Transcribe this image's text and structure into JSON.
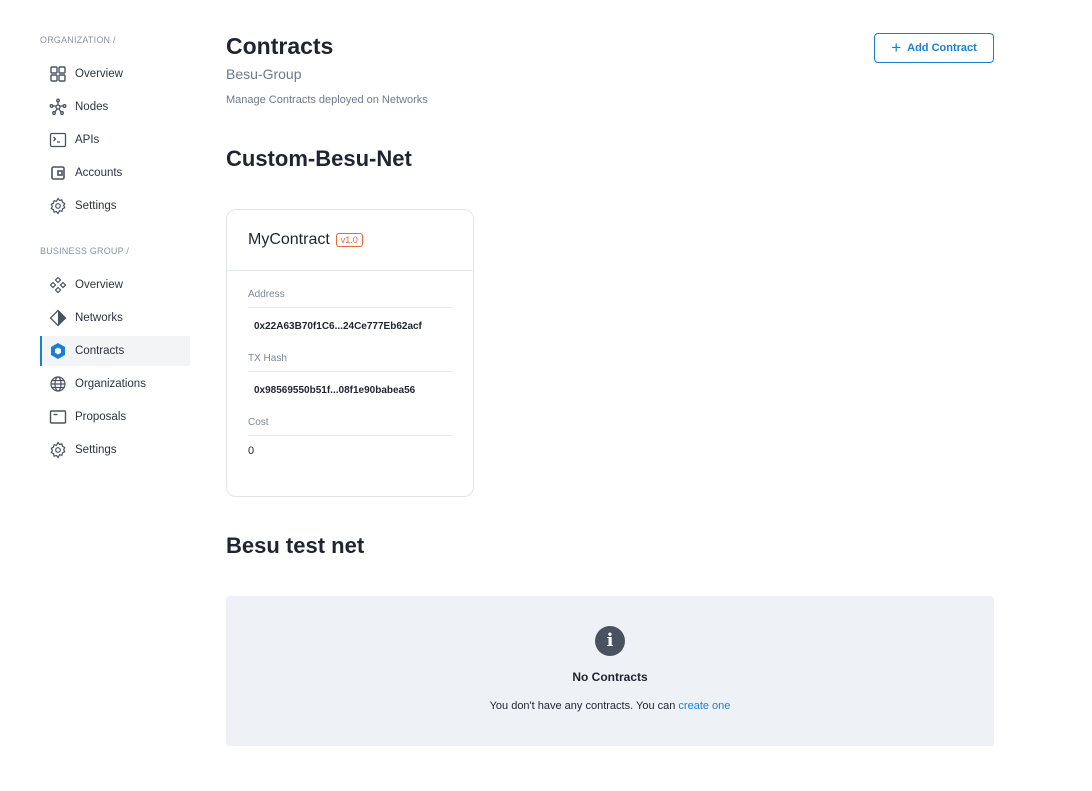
{
  "sidebar": {
    "org_label": "ORGANIZATION /",
    "org_items": [
      {
        "label": "Overview",
        "icon": "grid-icon"
      },
      {
        "label": "Nodes",
        "icon": "nodes-icon"
      },
      {
        "label": "APIs",
        "icon": "terminal-icon"
      },
      {
        "label": "Accounts",
        "icon": "wallet-icon"
      },
      {
        "label": "Settings",
        "icon": "gear-icon"
      }
    ],
    "bg_label": "BUSINESS GROUP /",
    "bg_items": [
      {
        "label": "Overview",
        "icon": "diamonds-icon"
      },
      {
        "label": "Networks",
        "icon": "network-diamond-icon"
      },
      {
        "label": "Contracts",
        "icon": "hexagon-icon",
        "active": true
      },
      {
        "label": "Organizations",
        "icon": "globe-icon"
      },
      {
        "label": "Proposals",
        "icon": "proposal-icon"
      },
      {
        "label": "Settings",
        "icon": "gear-icon"
      }
    ]
  },
  "header": {
    "title": "Contracts",
    "subtitle": "Besu-Group",
    "description": "Manage Contracts deployed on Networks",
    "add_button": "Add Contract"
  },
  "networks": [
    {
      "name": "Custom-Besu-Net",
      "contracts": [
        {
          "name": "MyContract",
          "version": "v1.0",
          "address_label": "Address",
          "address": "0x22A63B70f1C6...24Ce777Eb62acf",
          "tx_label": "TX Hash",
          "tx": "0x98569550b51f...08f1e90babea56",
          "cost_label": "Cost",
          "cost": "0"
        }
      ]
    },
    {
      "name": "Besu test net",
      "empty": {
        "title": "No Contracts",
        "text": "You don't have any contracts. You can",
        "link": "create one"
      }
    }
  ],
  "colors": {
    "accent": "#1a7fd4",
    "badge": "#e5683a"
  }
}
